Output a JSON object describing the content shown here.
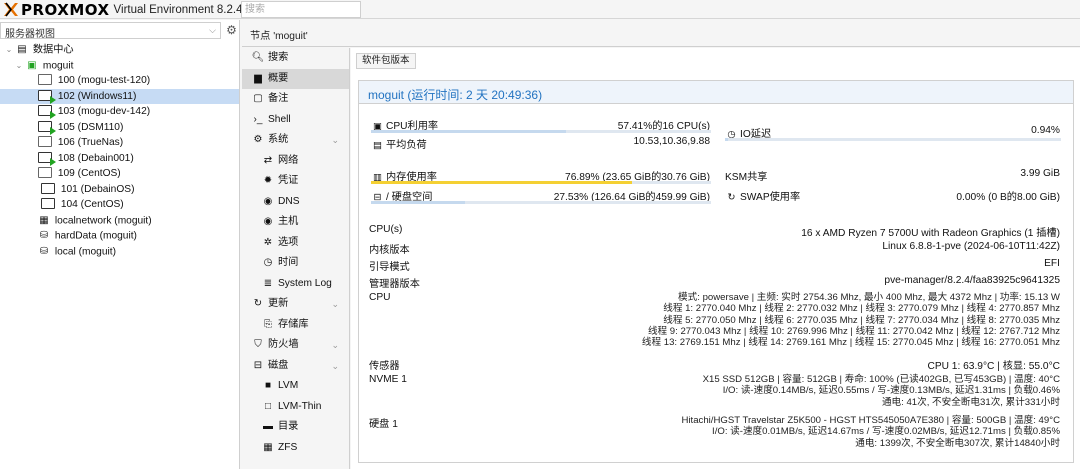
{
  "header": {
    "logo_text": "PROXMOX",
    "product": "Virtual Environment 8.2.4",
    "search_placeholder": "搜索"
  },
  "tree": {
    "view": "服务器视图",
    "nodes": [
      {
        "label": "数据中心",
        "type": "datacenter"
      },
      {
        "label": "moguit",
        "type": "node"
      },
      {
        "label": "100 (mogu-test-120)",
        "type": "vm-stopped"
      },
      {
        "label": "102 (Windows11)",
        "type": "vm-running"
      },
      {
        "label": "103 (mogu-dev-142)",
        "type": "vm-running"
      },
      {
        "label": "105 (DSM110)",
        "type": "vm-running"
      },
      {
        "label": "106 (TrueNas)",
        "type": "vm-stopped"
      },
      {
        "label": "108 (Debain001)",
        "type": "vm-running"
      },
      {
        "label": "109 (CentOS)",
        "type": "vm-stopped"
      },
      {
        "label": "101 (DebainOS)",
        "type": "template"
      },
      {
        "label": "104 (CentOS)",
        "type": "template"
      },
      {
        "label": "localnetwork (moguit)",
        "type": "network"
      },
      {
        "label": "hardData (moguit)",
        "type": "storage"
      },
      {
        "label": "local (moguit)",
        "type": "storage"
      }
    ]
  },
  "breadcrumb": "节点 'moguit'",
  "nav": [
    {
      "label": "搜索",
      "icon": "search-icon"
    },
    {
      "label": "概要",
      "icon": "book-icon",
      "active": true
    },
    {
      "label": "备注",
      "icon": "note-icon"
    },
    {
      "label": "Shell",
      "icon": "terminal-icon"
    },
    {
      "label": "系统",
      "icon": "gears-icon",
      "caret": true
    },
    {
      "label": "网络",
      "icon": "exchange-icon",
      "sub": true
    },
    {
      "label": "凭证",
      "icon": "certificate-icon",
      "sub": true
    },
    {
      "label": "DNS",
      "icon": "globe-icon",
      "sub": true
    },
    {
      "label": "主机",
      "icon": "globe-icon",
      "sub": true
    },
    {
      "label": "选项",
      "icon": "gear-icon",
      "sub": true
    },
    {
      "label": "时间",
      "icon": "clock-icon",
      "sub": true
    },
    {
      "label": "System Log",
      "icon": "list-icon",
      "sub": true
    },
    {
      "label": "更新",
      "icon": "refresh-icon",
      "caret": true
    },
    {
      "label": "存储库",
      "icon": "files-icon",
      "sub": true
    },
    {
      "label": "防火墙",
      "icon": "shield-icon",
      "caret": true
    },
    {
      "label": "磁盘",
      "icon": "hdd-icon",
      "caret": true
    },
    {
      "label": "LVM",
      "icon": "square-icon",
      "sub": true
    },
    {
      "label": "LVM-Thin",
      "icon": "square-outline-icon",
      "sub": true
    },
    {
      "label": "目录",
      "icon": "folder-icon",
      "sub": true
    },
    {
      "label": "ZFS",
      "icon": "grid-icon",
      "sub": true
    }
  ],
  "summary": {
    "button": "软件包版本",
    "title": "moguit (运行时间: 2 天 20:49:36)",
    "cpu_usage_label": "CPU利用率",
    "cpu_usage_value": "57.41%的16 CPU(s)",
    "cpu_usage_fraction": 0.5741,
    "load_label": "平均负荷",
    "load_value": "10.53,10.36,9.88",
    "io_label": "IO延迟",
    "io_value": "0.94%",
    "io_fraction": 0.0094,
    "mem_label": "内存使用率",
    "mem_value": "76.89% (23.65 GiB的30.76 GiB)",
    "mem_fraction": 0.7689,
    "ksm_label": "KSM共享",
    "ksm_value": "3.99 GiB",
    "disk_label": "/ 硬盘空间",
    "disk_value": "27.53% (126.64 GiB的459.99 GiB)",
    "disk_fraction": 0.2753,
    "swap_label": "SWAP使用率",
    "swap_value": "0.00% (0 B的8.00 GiB)",
    "cpus_label": "CPU(s)",
    "cpus_value": "16 x AMD Ryzen 7 5700U with Radeon Graphics (1 插槽)",
    "kernel_label": "内核版本",
    "kernel_value": "Linux 6.8.8-1-pve (2024-06-10T11:42Z)",
    "boot_label": "引导模式",
    "boot_value": "EFI",
    "manager_label": "管理器版本",
    "manager_value": "pve-manager/8.2.4/faa83925c9641325",
    "cpu_label": "CPU",
    "cpu_lines": [
      "模式: powersave | 主频: 实时 2754.36 Mhz, 最小 400 Mhz, 最大 4372 Mhz | 功率: 15.13 W",
      "线程 1: 2770.040 Mhz | 线程 2: 2770.032 Mhz | 线程 3: 2770.079 Mhz | 线程 4: 2770.857 Mhz",
      "线程 5: 2770.050 Mhz | 线程 6: 2770.035 Mhz | 线程 7: 2770.034 Mhz | 线程 8: 2770.035 Mhz",
      "线程 9: 2770.043 Mhz | 线程 10: 2769.996 Mhz | 线程 11: 2770.042 Mhz | 线程 12: 2767.712 Mhz",
      "线程 13: 2769.151 Mhz | 线程 14: 2769.161 Mhz | 线程 15: 2770.045 Mhz | 线程 16: 2770.051 Mhz"
    ],
    "sensor_label": "传感器",
    "sensor_value": "CPU 1: 63.9°C | 核显: 55.0°C",
    "nvme_label": "NVME 1",
    "nvme_lines": [
      "X15 SSD 512GB | 容量: 512GB | 寿命: 100% (已读402GB, 已写453GB) | 温度: 40°C",
      "I/O: 读-速度0.14MB/s, 延迟0.55ms / 写-速度0.13MB/s, 延迟1.31ms | 负载0.46%",
      "通电: 41次, 不安全断电31次, 累计331小时"
    ],
    "disk1_label": "硬盘 1",
    "disk1_lines": [
      "Hitachi/HGST Travelstar Z5K500 - HGST HTS545050A7E380 | 容量: 500GB | 温度: 49°C",
      "I/O: 读-速度0.01MB/s, 延迟14.67ms / 写-速度0.02MB/s, 延迟12.71ms | 负载0.85%",
      "通电: 1399次, 不安全断电307次, 累计14840小时"
    ]
  }
}
